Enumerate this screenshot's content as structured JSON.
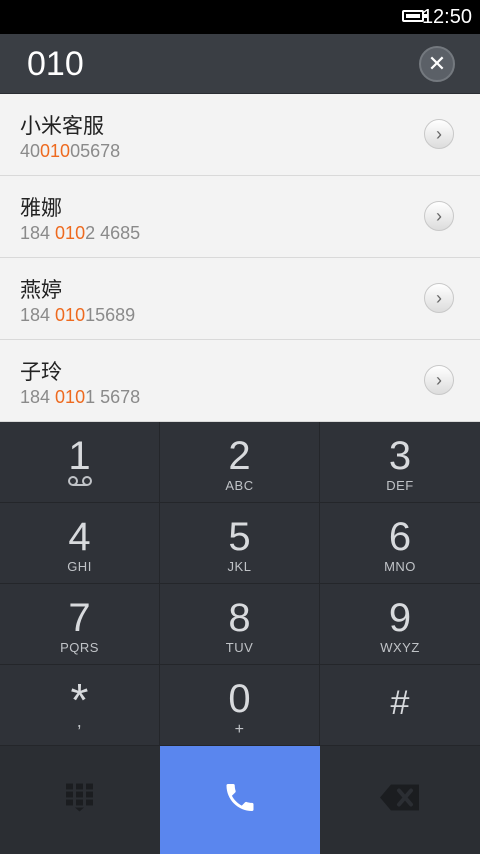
{
  "status": {
    "time": "12:50"
  },
  "header": {
    "query": "010",
    "clear_icon": "close-icon"
  },
  "results": [
    {
      "name": "小米客服",
      "number_pre": "40",
      "number_hl": "010",
      "number_post": "05678"
    },
    {
      "name": "雅娜",
      "number_pre": "184 ",
      "number_hl": "010",
      "number_post": "2 4685"
    },
    {
      "name": "燕婷",
      "number_pre": "184 ",
      "number_hl": "010",
      "number_post": "15689"
    },
    {
      "name": "子玲",
      "number_pre": "184 ",
      "number_hl": "010",
      "number_post": "1 5678"
    }
  ],
  "keypad": [
    {
      "digit": "1",
      "letters": ""
    },
    {
      "digit": "2",
      "letters": "ABC"
    },
    {
      "digit": "3",
      "letters": "DEF"
    },
    {
      "digit": "4",
      "letters": "GHI"
    },
    {
      "digit": "5",
      "letters": "JKL"
    },
    {
      "digit": "6",
      "letters": "MNO"
    },
    {
      "digit": "7",
      "letters": "PQRS"
    },
    {
      "digit": "8",
      "letters": "TUV"
    },
    {
      "digit": "9",
      "letters": "WXYZ"
    },
    {
      "digit": "*",
      "letters": ","
    },
    {
      "digit": "0",
      "letters": "+"
    },
    {
      "digit": "#",
      "letters": ""
    }
  ],
  "colors": {
    "highlight": "#ee6a1f",
    "call": "#5a86ee"
  }
}
